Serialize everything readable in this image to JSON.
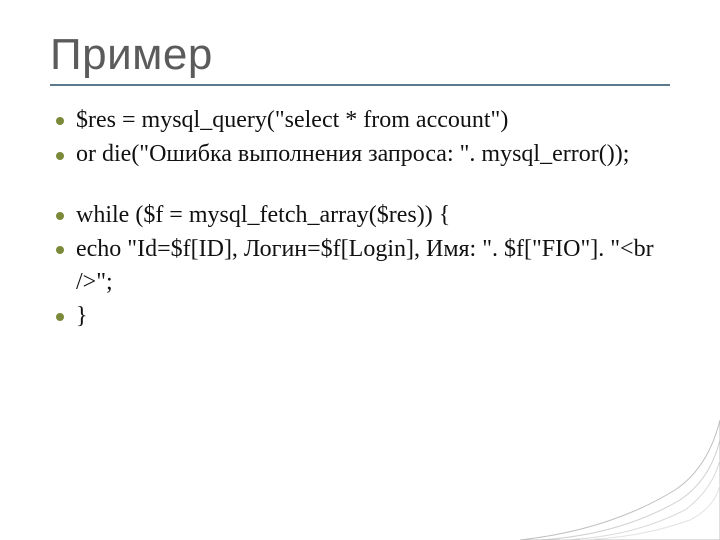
{
  "title": "Пример",
  "bullets": [
    "$res = mysql_query(\"select * from account\")",
    "    or die(\"Ошибка выполнения запроса: \". mysql_error());",
    "while ($f = mysql_fetch_array($res)) {",
    "    echo \"Id=$f[ID], Логин=$f[Login], Имя: \". $f[\"FIO\"]. \"<br />\";",
    "}"
  ],
  "gap_after_index": 1
}
